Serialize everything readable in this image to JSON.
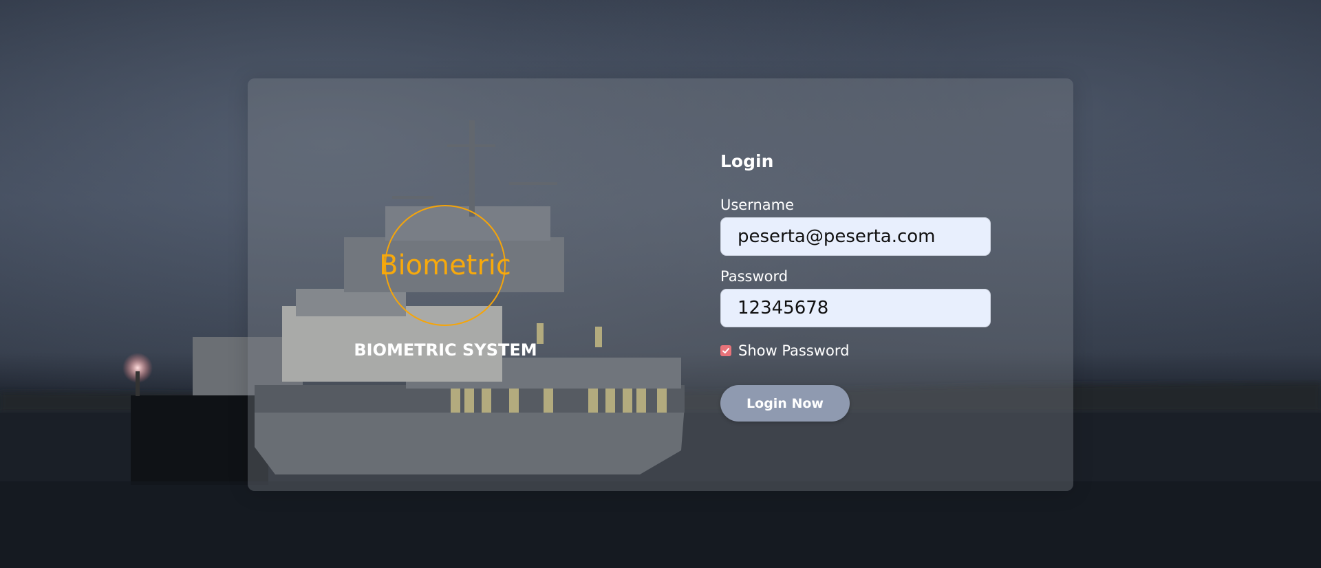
{
  "brand": {
    "logo_text": "Biometric",
    "title": "BIOMETRIC SYSTEM"
  },
  "login": {
    "title": "Login",
    "username_label": "Username",
    "username_value": "peserta@peserta.com",
    "password_label": "Password",
    "password_value": "12345678",
    "show_password_label": "Show Password",
    "show_password_checked": true,
    "submit_label": "Login Now"
  },
  "colors": {
    "logo_accent": "#f7a90c",
    "input_background": "#e8effd",
    "checkbox": "#e8737a",
    "button": "#8f9ab0"
  },
  "icons": {
    "checkbox_mark": "checkmark-icon"
  }
}
